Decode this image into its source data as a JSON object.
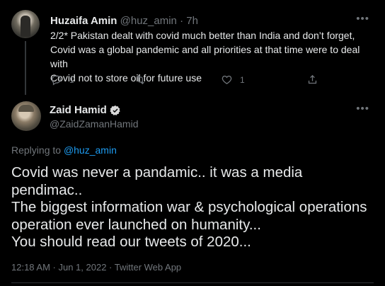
{
  "parent_tweet": {
    "name": "Huzaifa Amin",
    "handle": "@huz_amin",
    "separator": "·",
    "time": "7h",
    "lines": [
      "2/2* Pakistan dealt with covid much better than India and don’t forget,",
      "Covid was a global pandemic and all priorities at that time were to deal with",
      "Covid not to store oil for future use"
    ],
    "reply_count": "1",
    "like_count": "1"
  },
  "main_tweet": {
    "name": "Zaid Hamid",
    "handle": "@ZaidZamanHamid",
    "replying_prefix": "Replying to",
    "replying_to": "@huz_amin",
    "lines": [
      "Covid was never a pandamic.. it was a media",
      "pendimac..",
      "The biggest information war & psychological operations",
      "operation ever launched on humanity...",
      "You should read our tweets of 2020..."
    ],
    "timestamp": "12:18 AM · Jun 1, 2022 · Twitter Web App"
  },
  "colors": {
    "background": "#000000",
    "text": "#e7e9ea",
    "muted": "#71767b",
    "link": "#1d9bf0",
    "verified": "#d9d9d9"
  },
  "icons": [
    "more-icon",
    "reply-icon",
    "retweet-icon",
    "like-icon",
    "share-icon",
    "verified-badge-icon"
  ]
}
